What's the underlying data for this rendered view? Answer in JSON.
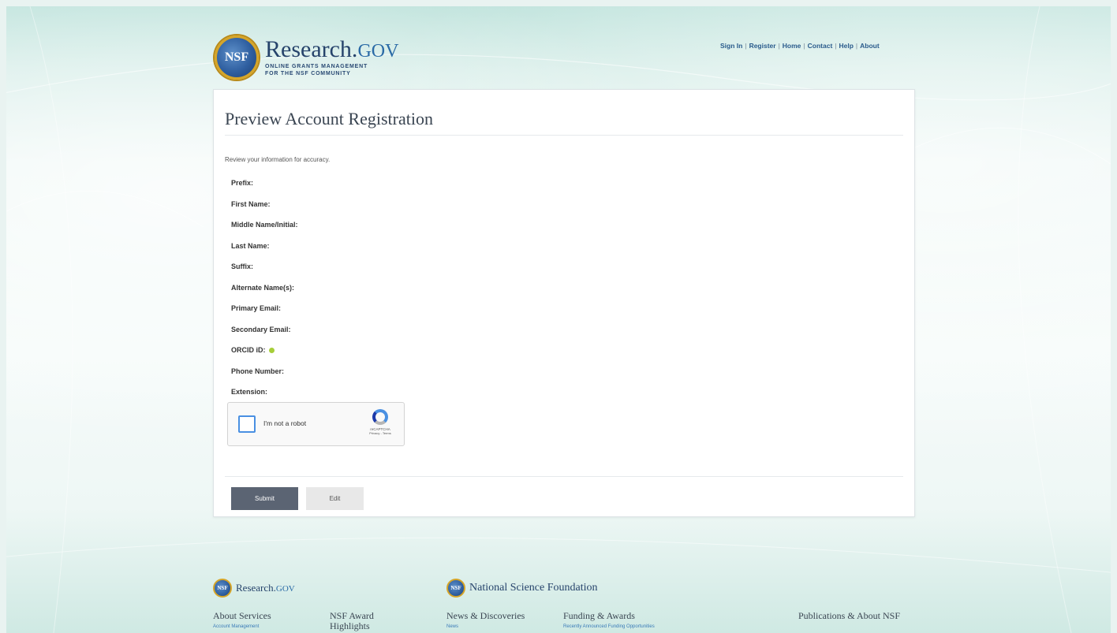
{
  "header": {
    "logo_main": "Research.",
    "logo_gov": "GOV",
    "logo_sub1": "ONLINE GRANTS MANAGEMENT",
    "logo_sub2": "FOR THE NSF COMMUNITY",
    "seal_text": "NSF",
    "nav": [
      "Sign In",
      "Register",
      "Home",
      "Contact",
      "Help",
      "About"
    ]
  },
  "page": {
    "title": "Preview Account Registration",
    "intro": "Review your information for accuracy.",
    "fields": [
      "Prefix:",
      "First Name:",
      "Middle Name/Initial:",
      "Last Name:",
      "Suffix:",
      "Alternate Name(s):",
      "Primary Email:",
      "Secondary Email:",
      "ORCID iD:",
      "Phone Number:",
      "Extension:"
    ],
    "captcha": {
      "label": "I'm not a robot",
      "brand": "reCAPTCHA",
      "terms": "Privacy - Terms"
    },
    "submit_label": "Submit",
    "edit_label": "Edit"
  },
  "footer": {
    "research_logo": "Research.",
    "research_gov": "GOV",
    "nsf_logo": "National Science Foundation",
    "seal_text": "NSF",
    "columns": [
      {
        "title": "About Services",
        "sub": "Account Management"
      },
      {
        "title": "NSF Award Highlights",
        "sub": ""
      },
      {
        "title": "News & Discoveries",
        "sub": "News"
      },
      {
        "title": "Funding & Awards",
        "sub": "Recently Announced Funding Opportunities"
      },
      {
        "title": "Publications & About NSF",
        "sub": ""
      }
    ]
  },
  "colors": {
    "brand_navy": "#26436b",
    "link_blue": "#2a5b8c",
    "submit_bg": "#5b6473",
    "orcid_green": "#a6ce39"
  }
}
